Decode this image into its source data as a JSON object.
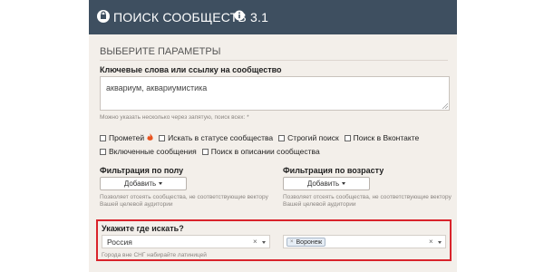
{
  "header": {
    "title": "ПОИСК СООБЩЕСТВ 3.1",
    "brand_color": "#3e4f60"
  },
  "section_title": "ВЫБЕРИТЕ ПАРАМЕТРЫ",
  "keywords": {
    "label": "Ключевые слова или ссылку на сообщество",
    "value": "аквариум, аквариумистика",
    "hint": "Можно указать несколько через запятую, поиск всех: *"
  },
  "checkboxes": [
    {
      "label": "Прометей",
      "checked": false
    },
    {
      "label": "Искать в статусе сообщества",
      "checked": false
    },
    {
      "label": "Строгий поиск",
      "checked": false
    },
    {
      "label": "Поиск в Вконтакте",
      "checked": false
    },
    {
      "label": "Включенные сообщения",
      "checked": false
    },
    {
      "label": "Поиск в описании сообщества",
      "checked": false
    }
  ],
  "gender_filter": {
    "label": "Фильтрация по полу",
    "button": "Добавить",
    "hint_line1": "Позволяет отсеять сообщества, не соответствующие вектору",
    "hint_line2": "Вашей целевой аудитории"
  },
  "age_filter": {
    "label": "Фильтрация по возрасту",
    "button": "Добавить",
    "hint_line1": "Позволяет отсеять сообщества, не соответствующие вектору",
    "hint_line2": "Вашей целевой аудитории"
  },
  "where": {
    "label": "Укажите где искать?",
    "country": "Россия",
    "city_tag": "Воронеж",
    "hint": "Города вне СНГ набирайте латиницей",
    "highlight_color": "#d9232b"
  }
}
